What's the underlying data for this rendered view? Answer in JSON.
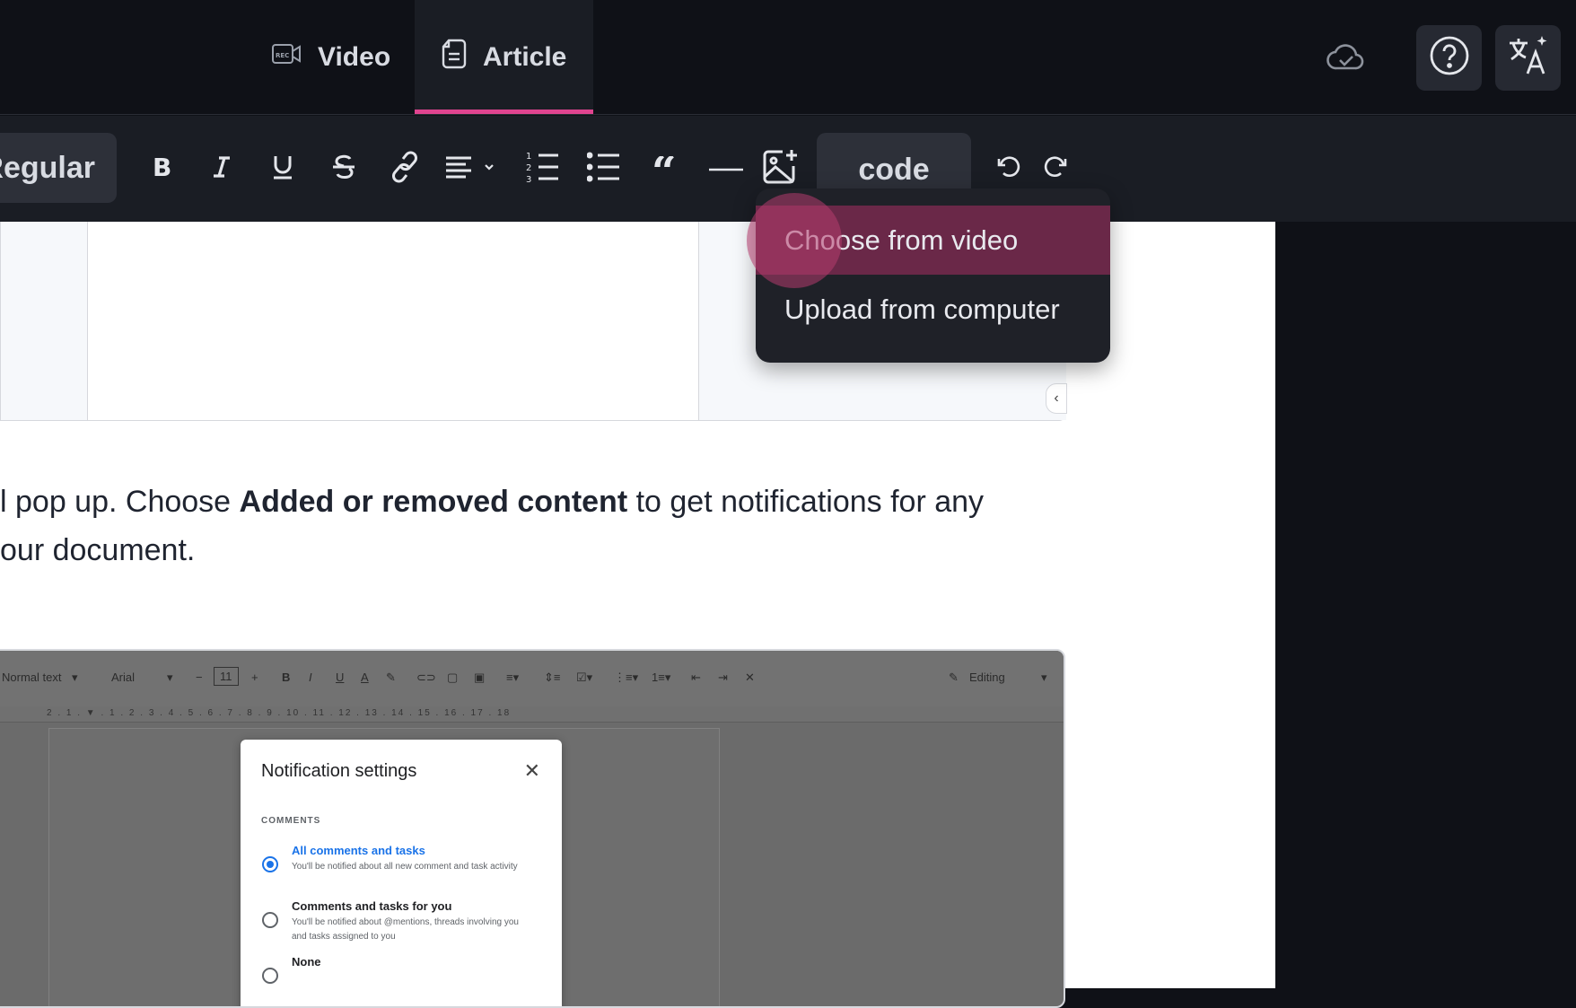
{
  "header": {
    "tabs": [
      {
        "label": "Video",
        "icon": "rec-camera-icon"
      },
      {
        "label": "Article",
        "icon": "document-icon",
        "active": true
      }
    ],
    "accent_color": "#e0448f"
  },
  "toolbar": {
    "style_label": "Regular",
    "code_label": "code"
  },
  "image_menu": {
    "items": [
      {
        "label": "Choose from video",
        "active": true
      },
      {
        "label": "Upload from computer"
      }
    ]
  },
  "article": {
    "para_line1_pre": "l pop up. Choose ",
    "para_line1_bold": "Added or removed content",
    "para_line1_post": " to get notifications for any",
    "para_line2": "our document."
  },
  "screenshot": {
    "toolbar_style": "Normal text",
    "toolbar_font": "Arial",
    "toolbar_size": "11",
    "toolbar_mode": "Editing",
    "ruler_marks": "2 . 1 . ▼ . 1 . 2 . 3 . 4 . 5 . 6 . 7 . 8 . 9 . 10 . 11 . 12 . 13 . 14 . 15 . 16 . 17 . 18",
    "modal": {
      "title": "Notification settings",
      "section": "COMMENTS",
      "options": [
        {
          "title": "All comments and tasks",
          "desc": "You'll be notified about all new comment and task activity",
          "selected": true
        },
        {
          "title": "Comments and tasks for you",
          "desc": "You'll be notified about @mentions, threads involving you and tasks assigned to you"
        },
        {
          "title": "None"
        }
      ]
    }
  }
}
